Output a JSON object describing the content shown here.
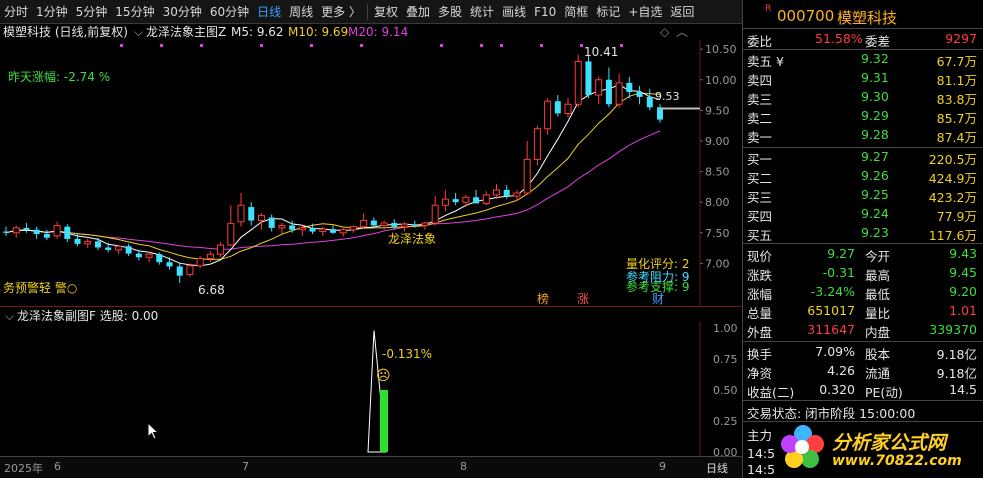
{
  "toolbar": {
    "items": [
      "分时",
      "1分钟",
      "5分钟",
      "15分钟",
      "30分钟",
      "60分钟",
      "日线",
      "周线",
      "更多 〉",
      "复权",
      "叠加",
      "多股",
      "统计",
      "画线",
      "F10",
      "简框",
      "标记",
      "+自选",
      "返回"
    ],
    "active": "日线"
  },
  "main_chart": {
    "stock_label": "模塑科技 (日线,前复权)",
    "indicator_name": "龙泽法象主图Z",
    "ma5": "M5: 9.62",
    "ma10": "M10: 9.69",
    "ma20": "M20: 9.14",
    "prev_change": "昨天涨幅: -2.74 %",
    "price_axis": [
      "10.50",
      "10.00",
      "9.50",
      "9.00",
      "8.50",
      "8.00",
      "7.50",
      "7.00"
    ],
    "high_marker": "10.41",
    "low_marker": "6.68",
    "last_marker": "9.53",
    "score": "量化评分: 2",
    "resistance": "参考阻力: 9",
    "support": "参考支撑: 9",
    "pattern_label": "龙泽法象",
    "warn_label": "务预警轻 警○",
    "tags": [
      "榜",
      "涨",
      "财"
    ],
    "colors": {
      "up": "#ff3b3b",
      "down": "#40e0ff",
      "ma5": "#ffffff",
      "ma10": "#f0d020",
      "ma20": "#e040e0"
    },
    "chart_data": {
      "type": "candlestick",
      "candles": [
        [
          7.52,
          7.6,
          7.45,
          7.5
        ],
        [
          7.5,
          7.62,
          7.42,
          7.58
        ],
        [
          7.58,
          7.66,
          7.5,
          7.55
        ],
        [
          7.55,
          7.6,
          7.4,
          7.48
        ],
        [
          7.48,
          7.55,
          7.38,
          7.42
        ],
        [
          7.45,
          7.68,
          7.4,
          7.62
        ],
        [
          7.6,
          7.64,
          7.35,
          7.4
        ],
        [
          7.4,
          7.48,
          7.28,
          7.32
        ],
        [
          7.32,
          7.4,
          7.25,
          7.36
        ],
        [
          7.36,
          7.42,
          7.22,
          7.26
        ],
        [
          7.26,
          7.34,
          7.18,
          7.22
        ],
        [
          7.22,
          7.3,
          7.15,
          7.28
        ],
        [
          7.28,
          7.32,
          7.12,
          7.16
        ],
        [
          7.16,
          7.22,
          7.05,
          7.1
        ],
        [
          7.1,
          7.2,
          7.02,
          7.15
        ],
        [
          7.15,
          7.18,
          6.98,
          7.02
        ],
        [
          7.02,
          7.1,
          6.9,
          6.95
        ],
        [
          6.95,
          7.0,
          6.68,
          6.8
        ],
        [
          6.82,
          7.0,
          6.78,
          6.96
        ],
        [
          6.96,
          7.12,
          6.92,
          7.08
        ],
        [
          7.08,
          7.2,
          7.02,
          7.15
        ],
        [
          7.15,
          7.35,
          7.1,
          7.3
        ],
        [
          7.3,
          7.95,
          7.28,
          7.65
        ],
        [
          7.68,
          8.15,
          7.6,
          7.95
        ],
        [
          7.92,
          8.0,
          7.62,
          7.7
        ],
        [
          7.7,
          7.82,
          7.55,
          7.78
        ],
        [
          7.75,
          7.8,
          7.52,
          7.58
        ],
        [
          7.58,
          7.66,
          7.48,
          7.62
        ],
        [
          7.62,
          7.7,
          7.5,
          7.55
        ],
        [
          7.55,
          7.62,
          7.45,
          7.58
        ],
        [
          7.58,
          7.65,
          7.48,
          7.52
        ],
        [
          7.52,
          7.6,
          7.45,
          7.56
        ],
        [
          7.56,
          7.62,
          7.48,
          7.5
        ],
        [
          7.5,
          7.58,
          7.44,
          7.55
        ],
        [
          7.55,
          7.62,
          7.5,
          7.6
        ],
        [
          7.6,
          7.82,
          7.56,
          7.7
        ],
        [
          7.7,
          7.75,
          7.58,
          7.62
        ],
        [
          7.62,
          7.7,
          7.55,
          7.66
        ],
        [
          7.66,
          7.72,
          7.55,
          7.6
        ],
        [
          7.6,
          7.68,
          7.52,
          7.64
        ],
        [
          7.64,
          7.7,
          7.58,
          7.62
        ],
        [
          7.62,
          7.68,
          7.55,
          7.66
        ],
        [
          7.66,
          8.1,
          7.62,
          7.95
        ],
        [
          7.95,
          8.2,
          7.85,
          8.05
        ],
        [
          8.05,
          8.15,
          7.95,
          8.0
        ],
        [
          8.0,
          8.12,
          7.92,
          8.08
        ],
        [
          8.08,
          8.2,
          8.0,
          7.98
        ],
        [
          7.98,
          8.18,
          7.95,
          8.12
        ],
        [
          8.12,
          8.3,
          8.05,
          8.2
        ],
        [
          8.2,
          8.28,
          8.05,
          8.1
        ],
        [
          8.1,
          8.2,
          8.02,
          8.15
        ],
        [
          8.15,
          9.0,
          8.12,
          8.7
        ],
        [
          8.7,
          9.25,
          8.6,
          9.2
        ],
        [
          9.2,
          9.7,
          9.1,
          9.65
        ],
        [
          9.65,
          9.75,
          9.4,
          9.45
        ],
        [
          9.45,
          9.7,
          9.38,
          9.6
        ],
        [
          9.6,
          10.41,
          9.55,
          10.3
        ],
        [
          10.3,
          10.4,
          9.7,
          9.75
        ],
        [
          9.75,
          10.05,
          9.6,
          10.0
        ],
        [
          10.0,
          10.2,
          9.55,
          9.6
        ],
        [
          9.6,
          10.1,
          9.55,
          9.95
        ],
        [
          9.95,
          10.05,
          9.7,
          9.8
        ],
        [
          9.8,
          9.9,
          9.6,
          9.72
        ],
        [
          9.72,
          9.85,
          9.5,
          9.55
        ],
        [
          9.55,
          9.6,
          9.3,
          9.35
        ]
      ],
      "ylim": [
        6.5,
        10.65
      ]
    }
  },
  "sub_chart": {
    "title": "龙泽法象副图F 选股: 0.00",
    "axis": [
      "1.00",
      "0.75",
      "0.50",
      "0.25",
      "0.00"
    ],
    "annotation": "-0.131%",
    "ylim": [
      0,
      1
    ]
  },
  "x_axis": {
    "labels": [
      "2025年",
      "6",
      "7",
      "8",
      "9"
    ],
    "period": "日线"
  },
  "quote": {
    "code": "000700",
    "name": "模塑科技",
    "webi_label": "委比",
    "webi": "51.58%",
    "weicha_label": "委差",
    "weicha": "9297",
    "asks": [
      [
        "卖五 ¥",
        "9.32",
        "67.7万"
      ],
      [
        "卖四",
        "9.31",
        "81.1万"
      ],
      [
        "卖三",
        "9.30",
        "83.8万"
      ],
      [
        "卖二",
        "9.29",
        "85.7万"
      ],
      [
        "卖一",
        "9.28",
        "87.4万"
      ]
    ],
    "bids": [
      [
        "买一",
        "9.27",
        "220.5万"
      ],
      [
        "买二",
        "9.26",
        "424.9万"
      ],
      [
        "买三",
        "9.25",
        "423.2万"
      ],
      [
        "买四",
        "9.24",
        "77.9万"
      ],
      [
        "买五",
        "9.23",
        "117.6万"
      ]
    ],
    "stats": [
      [
        "现价",
        "9.27",
        "今开",
        "9.43"
      ],
      [
        "涨跌",
        "-0.31",
        "最高",
        "9.45"
      ],
      [
        "涨幅",
        "-3.24%",
        "最低",
        "9.20"
      ],
      [
        "总量",
        "651017",
        "量比",
        "1.01"
      ],
      [
        "外盘",
        "311647",
        "内盘",
        "339370"
      ]
    ],
    "stats2": [
      [
        "换手",
        "7.09%",
        "股本",
        "9.18亿"
      ],
      [
        "净资",
        "4.26",
        "流通",
        "9.18亿"
      ],
      [
        "收益(二)",
        "0.320",
        "PE(动)",
        "14.5"
      ]
    ],
    "trade_status": "交易状态: 闭市阶段 15:00:00",
    "zhuli": "主力",
    "time1": "14:5",
    "time2": "14:5"
  },
  "logo": {
    "text": "分析家公式网",
    "url": "www.70822.com"
  }
}
